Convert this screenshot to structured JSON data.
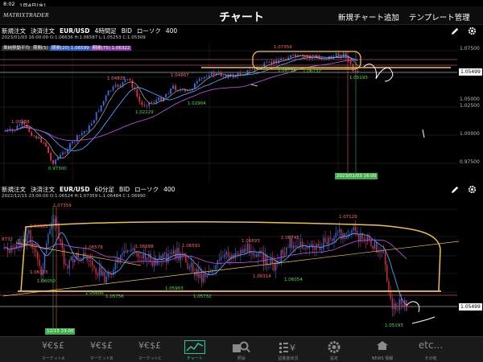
{
  "status_bar": {
    "time": "8:02",
    "date": "1月4日(水)"
  },
  "header": {
    "logo": "MATRIXTRADER",
    "title": "チャート",
    "new_chart": "新規チャート追加",
    "template": "テンプレート管理"
  },
  "top_panel": {
    "order_new": "新規注文",
    "order_settle": "決済注文",
    "symbol": "EUR/USD",
    "timeframe": "4時間足",
    "side": "BID",
    "chart_kind": "ローソク",
    "count": "400",
    "ohlc": "2023/01/03 16:00:00  O:1.06636  H:1.06587  L:1.05253  C:1.05309",
    "legend": [
      "単純移動平均",
      "期間(5)",
      "期間(20) 1.06599",
      "期間(75) 1.06322"
    ],
    "y_ticks": [
      "1.07500",
      "1.05000",
      "1.02500",
      "1.00000",
      "0.97500"
    ],
    "current_price": "1.05499",
    "cursor_time": "2023/01/03 16:00",
    "markers": [
      {
        "text": "1.07359",
        "color": "#ff6a6a"
      },
      {
        "text": "1.06594",
        "color": "#ff6a6a"
      },
      {
        "text": "1.04828",
        "color": "#ff6a6a"
      },
      {
        "text": "1.04867",
        "color": "#ff6a6a"
      },
      {
        "text": "1.00938",
        "color": "#ff6a6a"
      },
      {
        "text": "1.06759",
        "color": "#55dd55"
      },
      {
        "text": "1.06732",
        "color": "#55dd55"
      },
      {
        "text": "1.05193",
        "color": "#55dd55"
      },
      {
        "text": "1.02229",
        "color": "#55dd55"
      },
      {
        "text": "1.02904",
        "color": "#55dd55"
      },
      {
        "text": "0.97300",
        "color": "#55dd55"
      }
    ]
  },
  "bottom_panel": {
    "order_new": "新規注文",
    "order_settle": "決済注文",
    "symbol": "EUR/USD",
    "timeframe": "60分足",
    "side": "BID",
    "chart_kind": "ローソク",
    "count": "400",
    "ohlc": "2022/12/15 23:00:00  O:1.06524  H:1.07359  L:1.06484  C:1.06990",
    "current_price": "1.05499",
    "cursor_time": "12/15 23:00",
    "markers_high": [
      {
        "text": "1.07359"
      },
      {
        "text": "1.06983"
      },
      {
        "text": "1.06578"
      },
      {
        "text": "1.06588"
      },
      {
        "text": "1.06591"
      },
      {
        "text": "1.06693"
      },
      {
        "text": "1.06745"
      },
      {
        "text": "1.07129"
      },
      {
        "text": "1.06165"
      },
      {
        "text": "1.06314"
      },
      {
        "text": "8732"
      }
    ],
    "markers_low": [
      {
        "text": "1.06050"
      },
      {
        "text": "1.05606"
      },
      {
        "text": "1.05756"
      },
      {
        "text": "1.05903"
      },
      {
        "text": "1.05732"
      },
      {
        "text": "1.06054"
      },
      {
        "text": "1.05193"
      }
    ]
  },
  "tabs": [
    {
      "icon": "¥€$£",
      "label": "マーケットA"
    },
    {
      "icon": "¥€$£",
      "label": "マーケットB"
    },
    {
      "icon": "¥€$£",
      "label": "マーケットC"
    },
    {
      "icon": "chart-icon",
      "label": "チャート"
    },
    {
      "icon": "search-icon",
      "label": "照会"
    },
    {
      "icon": "report-icon",
      "label": "証拠金状況"
    },
    {
      "icon": "gear-icon",
      "label": "設定"
    },
    {
      "icon": "news-icon",
      "label": "NEWS 情報"
    },
    {
      "icon": "etc...",
      "label": "その他"
    }
  ],
  "colors": {
    "accent": "#28c79b",
    "bull": "#3a6fe0",
    "bear": "#e0334a",
    "sma_short": "#4fa0ff",
    "sma_mid": "#b04fd0",
    "annotation": "#f2c04a"
  }
}
